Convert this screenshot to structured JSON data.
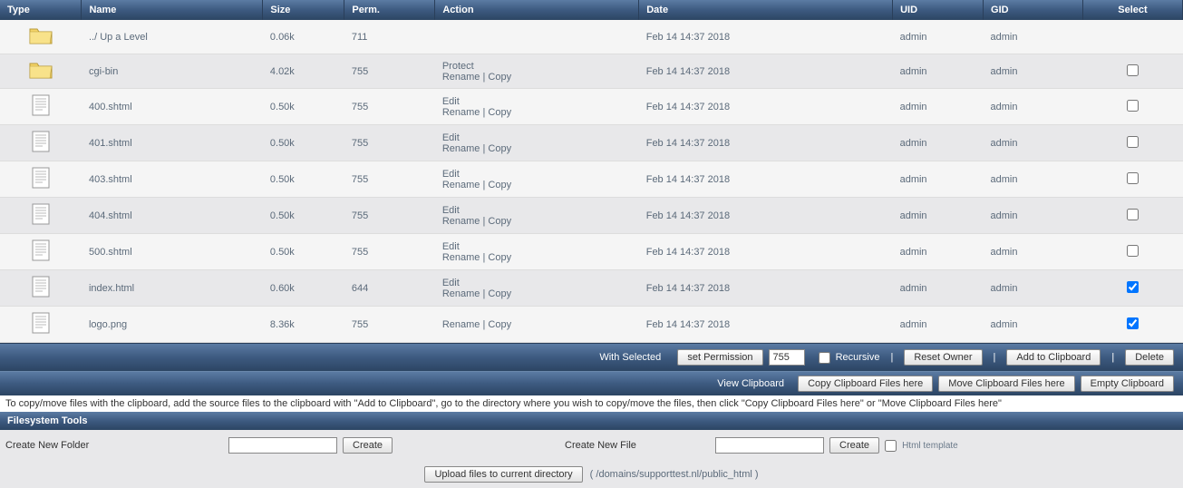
{
  "headers": {
    "type": "Type",
    "name": "Name",
    "size": "Size",
    "perm": "Perm.",
    "action": "Action",
    "date": "Date",
    "uid": "UID",
    "gid": "GID",
    "select": "Select"
  },
  "rows": [
    {
      "icon": "folder",
      "name": "../ Up a Level",
      "size": "0.06k",
      "perm": "711",
      "actions": [],
      "date": "Feb 14 14:37 2018",
      "uid": "admin",
      "gid": "admin",
      "select": null
    },
    {
      "icon": "folder",
      "name": "cgi-bin",
      "size": "4.02k",
      "perm": "755",
      "actions": [
        [
          "Protect"
        ],
        [
          "Rename",
          "Copy"
        ]
      ],
      "date": "Feb 14 14:37 2018",
      "uid": "admin",
      "gid": "admin",
      "select": false
    },
    {
      "icon": "file",
      "name": "400.shtml",
      "size": "0.50k",
      "perm": "755",
      "actions": [
        [
          "Edit"
        ],
        [
          "Rename",
          "Copy"
        ]
      ],
      "date": "Feb 14 14:37 2018",
      "uid": "admin",
      "gid": "admin",
      "select": false
    },
    {
      "icon": "file",
      "name": "401.shtml",
      "size": "0.50k",
      "perm": "755",
      "actions": [
        [
          "Edit"
        ],
        [
          "Rename",
          "Copy"
        ]
      ],
      "date": "Feb 14 14:37 2018",
      "uid": "admin",
      "gid": "admin",
      "select": false
    },
    {
      "icon": "file",
      "name": "403.shtml",
      "size": "0.50k",
      "perm": "755",
      "actions": [
        [
          "Edit"
        ],
        [
          "Rename",
          "Copy"
        ]
      ],
      "date": "Feb 14 14:37 2018",
      "uid": "admin",
      "gid": "admin",
      "select": false
    },
    {
      "icon": "file",
      "name": "404.shtml",
      "size": "0.50k",
      "perm": "755",
      "actions": [
        [
          "Edit"
        ],
        [
          "Rename",
          "Copy"
        ]
      ],
      "date": "Feb 14 14:37 2018",
      "uid": "admin",
      "gid": "admin",
      "select": false
    },
    {
      "icon": "file",
      "name": "500.shtml",
      "size": "0.50k",
      "perm": "755",
      "actions": [
        [
          "Edit"
        ],
        [
          "Rename",
          "Copy"
        ]
      ],
      "date": "Feb 14 14:37 2018",
      "uid": "admin",
      "gid": "admin",
      "select": false
    },
    {
      "icon": "file",
      "name": "index.html",
      "size": "0.60k",
      "perm": "644",
      "actions": [
        [
          "Edit"
        ],
        [
          "Rename",
          "Copy"
        ]
      ],
      "date": "Feb 14 14:37 2018",
      "uid": "admin",
      "gid": "admin",
      "select": true
    },
    {
      "icon": "file",
      "name": "logo.png",
      "size": "8.36k",
      "perm": "755",
      "actions": [
        [
          "Rename",
          "Copy"
        ]
      ],
      "date": "Feb 14 14:37 2018",
      "uid": "admin",
      "gid": "admin",
      "select": true
    }
  ],
  "toolbar": {
    "with_selected": "With Selected",
    "set_permission": "set Permission",
    "perm_value": "755",
    "recursive": "Recursive",
    "reset_owner": "Reset Owner",
    "add_clipboard": "Add to Clipboard",
    "delete": "Delete",
    "view_clipboard": "View Clipboard",
    "copy_here": "Copy Clipboard Files here",
    "move_here": "Move Clipboard Files here",
    "empty_clipboard": "Empty Clipboard"
  },
  "help_text": "To copy/move files with the clipboard, add the source files to the clipboard with \"Add to Clipboard\", go to the directory where you wish to copy/move the files, then click \"Copy Clipboard Files here\" or \"Move Clipboard Files here\"",
  "fs_tools": {
    "header": "Filesystem Tools",
    "create_folder": "Create New Folder",
    "create_file": "Create New File",
    "create_btn": "Create",
    "html_template": "Html template",
    "upload": "Upload files to current directory",
    "path": "( /domains/supporttest.nl/public_html )"
  }
}
